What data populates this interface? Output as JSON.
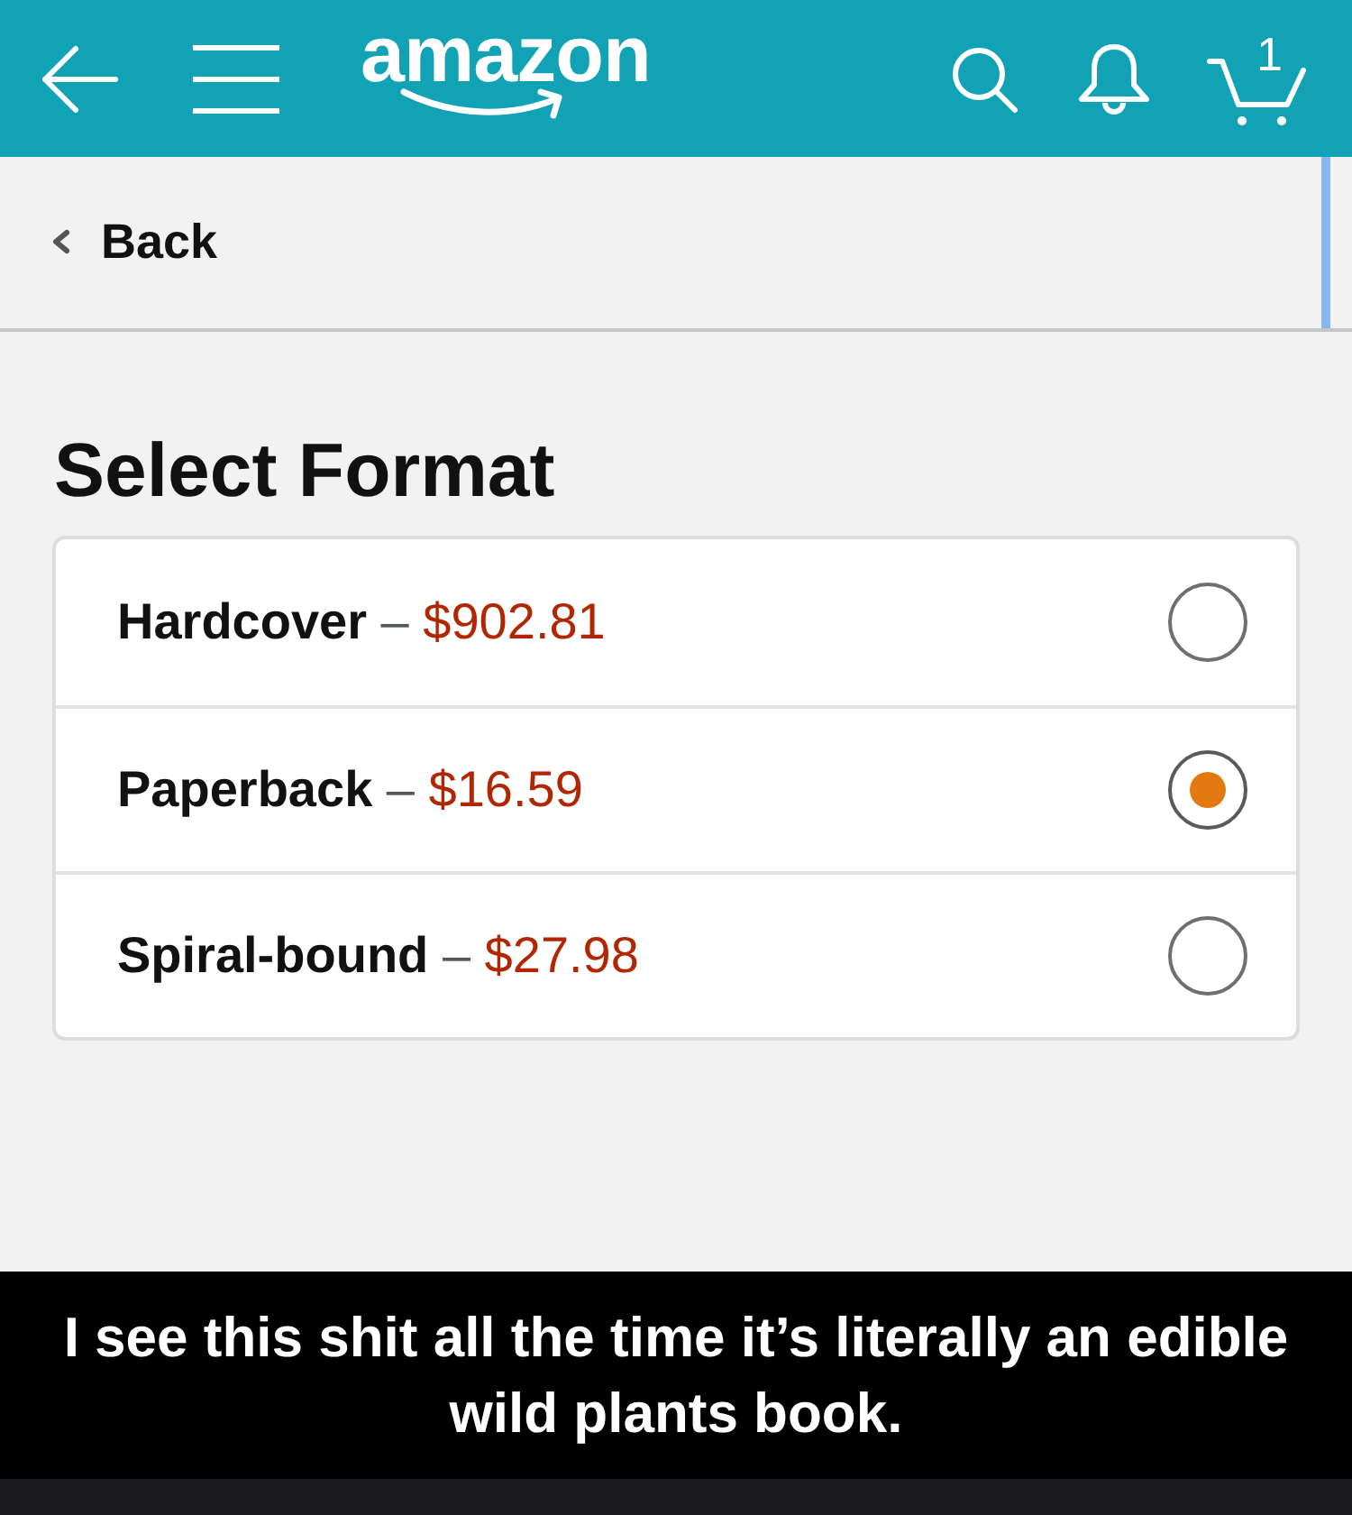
{
  "header": {
    "logo": "amazon",
    "cart_count": "1"
  },
  "back_link": {
    "label": "Back"
  },
  "heading": "Select Format",
  "formats": [
    {
      "name": "Hardcover",
      "separator": "–",
      "price": "$902.81",
      "selected": false
    },
    {
      "name": "Paperback",
      "separator": "–",
      "price": "$16.59",
      "selected": true
    },
    {
      "name": "Spiral-bound",
      "separator": "–",
      "price": "$27.98",
      "selected": false
    }
  ],
  "caption": "I see this shit all the time it’s literally an edible wild plants book."
}
